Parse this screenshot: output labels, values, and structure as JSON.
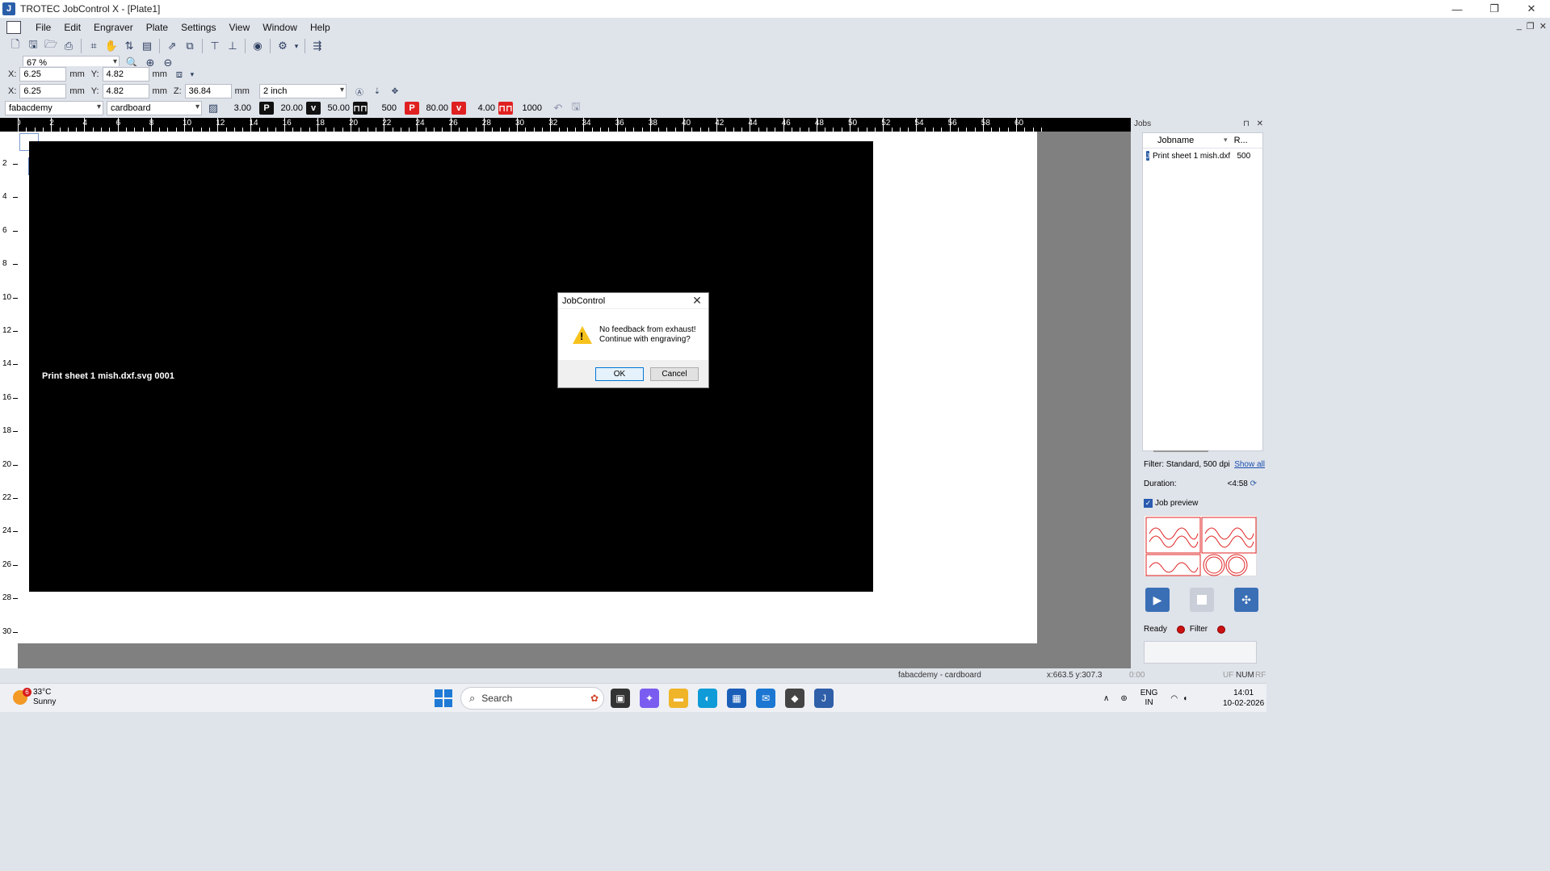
{
  "window": {
    "title": "TROTEC JobControl X - [Plate1]",
    "app_icon_glyph": "J",
    "minimize": "—",
    "maximize": "❐",
    "close": "✕"
  },
  "menu": {
    "items": [
      "File",
      "Edit",
      "Engraver",
      "Plate",
      "Settings",
      "View",
      "Window",
      "Help"
    ],
    "mdi": {
      "minimize": "_",
      "restore": "❐",
      "close": "✕"
    }
  },
  "zoom": {
    "value": "67 %"
  },
  "position_bar": {
    "x_label": "X:",
    "x": "6.25",
    "y_label": "Y:",
    "y": "4.82",
    "unit": "mm"
  },
  "size_bar": {
    "x_label": "X:",
    "x": "6.25",
    "y_label": "Y:",
    "y": "4.82",
    "z_label": "Z:",
    "z": "36.84",
    "unit": "mm",
    "lens": "2 inch"
  },
  "material_bar": {
    "material_db": "fabacdemy",
    "material": "cardboard",
    "thickness": "3.00",
    "engrave_power_icon": "P",
    "engrave_power": "20.00",
    "engrave_speed_icon": "v",
    "engrave_speed": "50.00",
    "engrave_freq": "500",
    "cut_power_icon": "P",
    "cut_power": "80.00",
    "cut_speed_icon": "v",
    "cut_speed": "4.00",
    "cut_freq": "1000"
  },
  "rulers": {
    "horizontal": [
      "0",
      "2",
      "4",
      "6",
      "8",
      "10",
      "12",
      "14",
      "16",
      "18",
      "20",
      "22",
      "24",
      "26",
      "28",
      "30",
      "32",
      "34",
      "36",
      "38",
      "40",
      "42",
      "44",
      "46",
      "48",
      "50",
      "52",
      "54",
      "56",
      "58",
      "60"
    ],
    "vertical": [
      "2",
      "4",
      "6",
      "8",
      "10",
      "12",
      "14",
      "16",
      "18",
      "20",
      "22",
      "24",
      "26",
      "28",
      "30"
    ]
  },
  "canvas": {
    "job_label": "Print sheet 1 mish.dxf.svg 0001"
  },
  "dialog": {
    "title": "JobControl",
    "close": "✕",
    "message_line1": "No feedback from exhaust!",
    "message_line2": "Continue with engraving?",
    "ok": "OK",
    "cancel": "Cancel"
  },
  "jobs_panel": {
    "title": "Jobs",
    "pin": "⊓",
    "close": "✕",
    "col_jobname": "Jobname",
    "col_r": "R...",
    "jobs": [
      {
        "name": "Print sheet 1 mish.dxf....",
        "r": "500"
      }
    ],
    "filter_text": "Filter: Standard, 500 dpi",
    "show_all": "Show all",
    "duration_label": "Duration:",
    "duration_value": "<4:58",
    "job_preview_label": "Job preview",
    "ready_label": "Ready",
    "filter_label": "Filter"
  },
  "statusbar": {
    "profile": "fabacdemy - cardboard",
    "coords": "x:663.5   y:307.3",
    "time": "0:00",
    "uf": "UF",
    "num": "NUM",
    "rf": "RF"
  },
  "taskbar": {
    "weather_temp": "33°C",
    "weather_desc": "Sunny",
    "weather_badge": "6",
    "search_placeholder": "Search",
    "lang_line1": "ENG",
    "lang_line2": "IN",
    "time": "14:01",
    "date": "10-02-2026"
  },
  "colors": {
    "accent": "#2f5fa8",
    "warning": "#f7c21c",
    "led_red": "#cc1111",
    "cut_red": "#e02020"
  }
}
